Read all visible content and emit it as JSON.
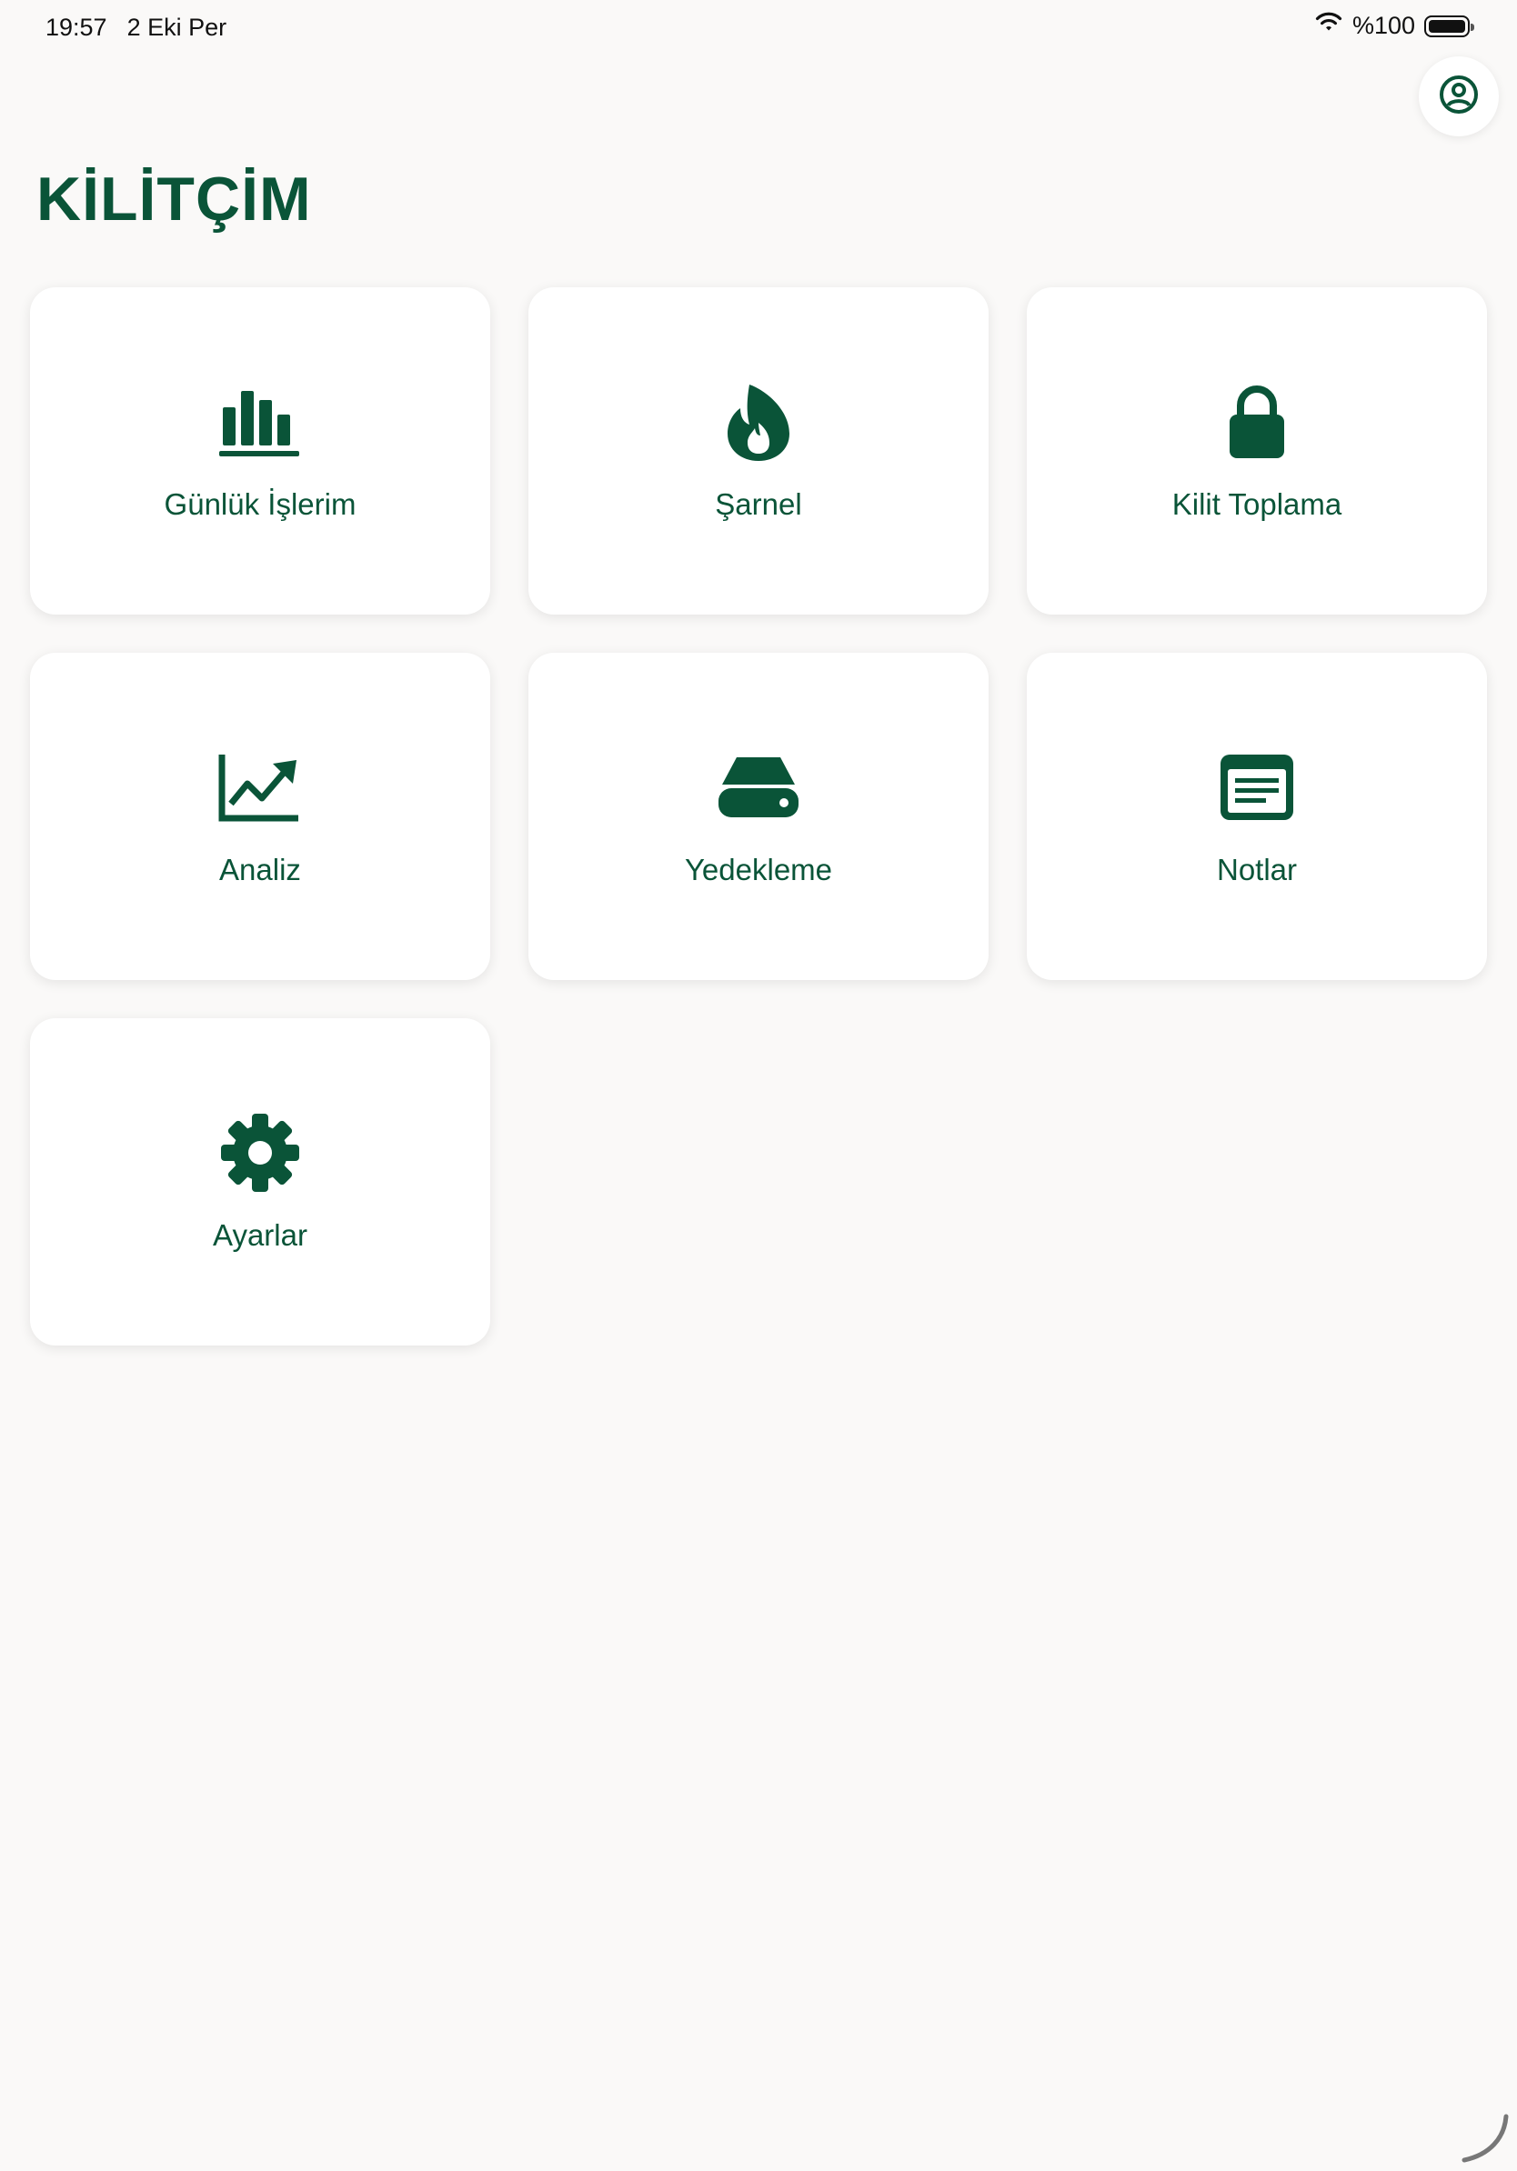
{
  "status_bar": {
    "time": "19:57",
    "date": "2 Eki Per",
    "battery": "%100",
    "battery_level": 1.0
  },
  "header": {
    "title": "KİLİTÇİM",
    "profile_icon": "person-circle-icon"
  },
  "tiles": [
    {
      "label": "Günlük İşlerim",
      "icon": "bar-chart-icon"
    },
    {
      "label": "Şarnel",
      "icon": "flame-icon"
    },
    {
      "label": "Kilit Toplama",
      "icon": "lock-icon"
    },
    {
      "label": "Analiz",
      "icon": "trend-chart-icon"
    },
    {
      "label": "Yedekleme",
      "icon": "hard-drive-icon"
    },
    {
      "label": "Notlar",
      "icon": "notes-icon"
    },
    {
      "label": "Ayarlar",
      "icon": "gear-icon"
    }
  ],
  "colors": {
    "accent": "#0a5438",
    "background": "#faf9f8",
    "card": "#ffffff"
  }
}
